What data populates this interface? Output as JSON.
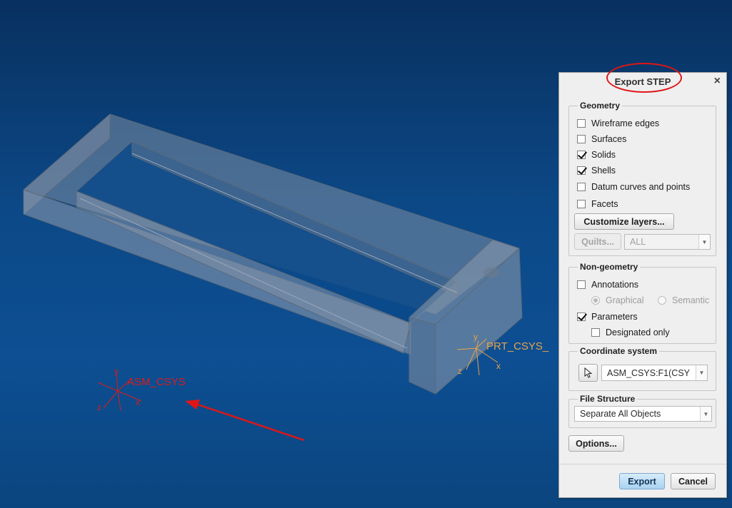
{
  "viewport": {
    "asm_csys_label": "ASM_CSYS",
    "prt_csys_label": "PRT_CSYS_",
    "axis_x": "x",
    "axis_y": "y",
    "axis_z": "z"
  },
  "dialog": {
    "title": "Export STEP",
    "close_icon": "×",
    "geometry": {
      "title": "Geometry",
      "options": [
        {
          "label": "Wireframe edges",
          "checked": false
        },
        {
          "label": "Surfaces",
          "checked": false
        },
        {
          "label": "Solids",
          "checked": true
        },
        {
          "label": "Shells",
          "checked": true
        },
        {
          "label": "Datum curves and points",
          "checked": false
        },
        {
          "label": "Facets",
          "checked": false
        }
      ],
      "customize_layers_label": "Customize layers...",
      "quilts_label": "Quilts...",
      "quilts_select_value": "ALL"
    },
    "non_geometry": {
      "title": "Non-geometry",
      "annotations": {
        "label": "Annotations",
        "checked": false
      },
      "graphical": {
        "label": "Graphical",
        "selected": true
      },
      "semantic": {
        "label": "Semantic",
        "selected": false
      },
      "parameters": {
        "label": "Parameters",
        "checked": true
      },
      "designated_only": {
        "label": "Designated only",
        "checked": false
      }
    },
    "coordinate_system": {
      "title": "Coordinate system",
      "select_icon": "cursor-arrow-icon",
      "value": "ASM_CSYS:F1(CSY"
    },
    "file_structure": {
      "title": "File Structure",
      "value": "Separate All Objects"
    },
    "options_label": "Options...",
    "export_label": "Export",
    "cancel_label": "Cancel"
  },
  "colors": {
    "annotation_red": "#e01515",
    "csys_orange": "#e8a24a",
    "csys_red": "#d91c1c",
    "primary_button": "#a9d2f1"
  }
}
